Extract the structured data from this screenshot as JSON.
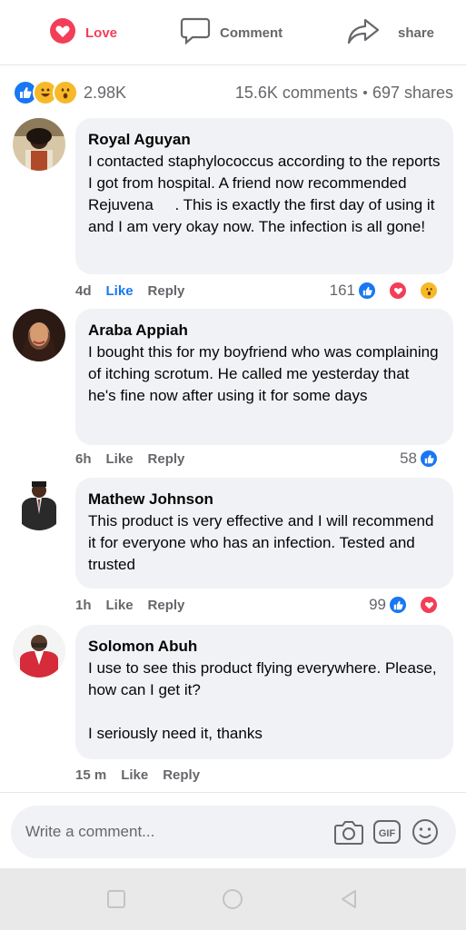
{
  "actions": {
    "love_label": "Love",
    "comment_label": "Comment",
    "share_label": "share"
  },
  "summary": {
    "reaction_count": "2.98K",
    "comments": "15.6K comments",
    "shares": "697 shares"
  },
  "comments": [
    {
      "author": "Royal Aguyan",
      "text": "I contacted staphylococcus according to the reports I got from hospital. A friend now recommended Rejuvena     . This is exactly the first day of using it and I am very okay now. The infection is all gone!",
      "time": "4d",
      "like_label": "Like",
      "reply_label": "Reply",
      "reaction_count": "161"
    },
    {
      "author": "Araba Appiah",
      "text": "I bought this for my boyfriend who was complaining of itching scrotum. He called me yesterday that he's fine now after using it for some days",
      "time": "6h",
      "like_label": "Like",
      "reply_label": "Reply",
      "reaction_count": "58"
    },
    {
      "author": "Mathew Johnson",
      "text": "This product is very effective and I will recommend it for everyone who has an infection. Tested and trusted",
      "time": "1h",
      "like_label": "Like",
      "reply_label": "Reply",
      "reaction_count": "99"
    },
    {
      "author": "Solomon Abuh",
      "text": "I use to see this product flying everywhere. Please, how can I get it?\n\nI seriously need it, thanks",
      "time": "15 m",
      "like_label": "Like",
      "reply_label": "Reply"
    }
  ],
  "composer": {
    "placeholder": "Write a comment..."
  },
  "colors": {
    "love": "#f33e58",
    "like_blue": "#1877f2",
    "meta_grey": "#65676b",
    "bubble_bg": "#f0f2f5"
  }
}
